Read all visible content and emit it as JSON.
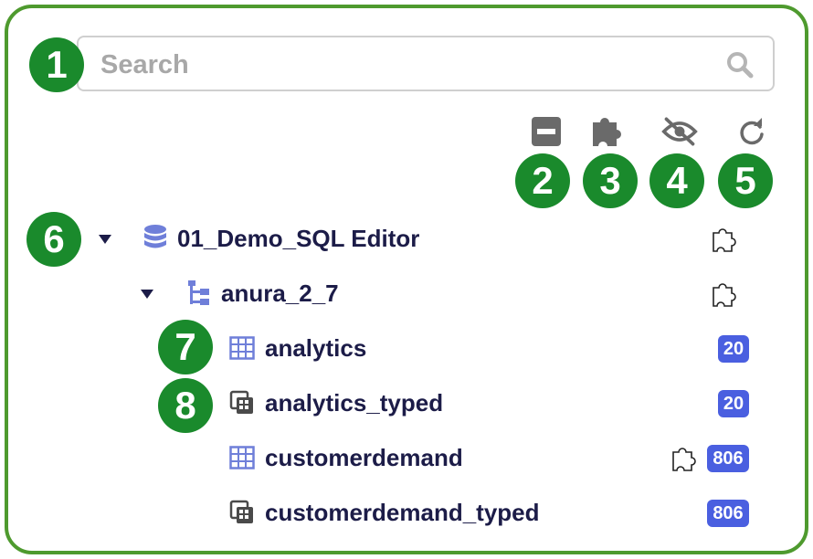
{
  "search": {
    "placeholder": "Search",
    "value": ""
  },
  "callouts": [
    "1",
    "2",
    "3",
    "4",
    "5",
    "6",
    "7",
    "8"
  ],
  "toolbar": {
    "icons": [
      "collapse-all-icon",
      "plugin-icon",
      "eye-off-icon",
      "refresh-icon"
    ]
  },
  "tree": {
    "database": {
      "label": "01_Demo_SQL Editor",
      "icon": "database-icon"
    },
    "schema": {
      "label": "anura_2_7",
      "icon": "schema-icon"
    },
    "tables": [
      {
        "label": "analytics",
        "icon": "table-icon",
        "count": "20"
      },
      {
        "label": "analytics_typed",
        "icon": "typed-table-icon",
        "count": "20"
      },
      {
        "label": "customerdemand",
        "icon": "table-icon",
        "count": "806"
      },
      {
        "label": "customerdemand_typed",
        "icon": "typed-table-icon",
        "count": "806"
      }
    ]
  },
  "colors": {
    "frame": "#4e9a2e",
    "callout": "#1a8a2c",
    "count_badge": "#4a5fe0",
    "tree_icon": "#6f7fd9",
    "text": "#1c1c48"
  }
}
